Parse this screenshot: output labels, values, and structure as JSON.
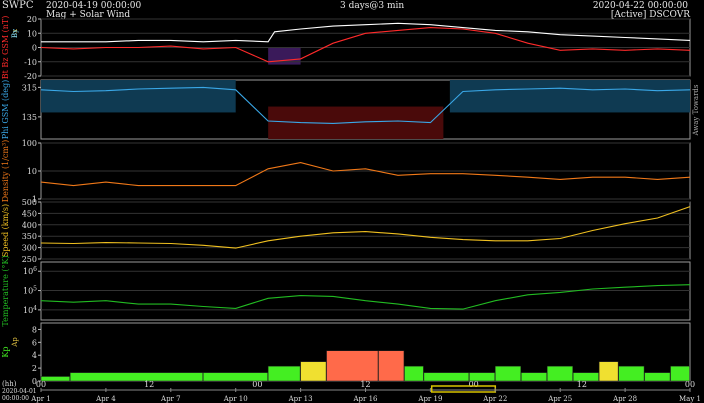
{
  "header": {
    "org": "SWPC",
    "range_start": "2020-04-19 00:00:00",
    "subtitle": "Mag + Solar Wind",
    "span": "3 days@3 min",
    "range_end": "2020-04-22 00:00:00",
    "source": "[Active] DSCOVR"
  },
  "colors": {
    "bt": "#ffffff",
    "bz": "#ff2a2a",
    "phi": "#3aa8e8",
    "density": "#f07818",
    "speed": "#f0c020",
    "temperature": "#22bb22",
    "kp_low": "#44ee22",
    "kp_mid": "#f0e030",
    "kp_high": "#ff6a4a",
    "slider": "#d9c400"
  },
  "side_label": "Away Towards",
  "time_axis": {
    "hour_label": "(hh)",
    "date_label": "2020-04-01",
    "time_label": "00:00:00",
    "hour_ticks": [
      "00",
      "12",
      "00",
      "12",
      "00",
      "12",
      "00"
    ],
    "date_ticks": [
      "Apr 1",
      "Apr 4",
      "Apr 7",
      "Apr 10",
      "Apr 13",
      "Apr 16",
      "Apr 19",
      "Apr 22",
      "Apr 25",
      "Apr 28",
      "May 1"
    ]
  },
  "chart_data": [
    {
      "type": "line",
      "ylabel": "Bt  Bz GSM (nT)",
      "extra_labels": [
        "Bx",
        "By"
      ],
      "yticks": [
        20,
        10,
        0,
        -10,
        -20
      ],
      "ylim": [
        -20,
        20
      ],
      "grid": true,
      "series": [
        {
          "name": "Bt",
          "x": [
            0,
            0.05,
            0.1,
            0.15,
            0.2,
            0.25,
            0.3,
            0.35,
            0.36,
            0.4,
            0.45,
            0.5,
            0.55,
            0.6,
            0.65,
            0.7,
            0.75,
            0.8,
            0.85,
            0.9,
            0.95,
            1
          ],
          "y": [
            4,
            4,
            4,
            5,
            5,
            4,
            5,
            4,
            11,
            13,
            15,
            16,
            17,
            16,
            14,
            12,
            11,
            9,
            8,
            7,
            6,
            5
          ]
        },
        {
          "name": "Bz",
          "x": [
            0,
            0.05,
            0.1,
            0.15,
            0.2,
            0.25,
            0.3,
            0.35,
            0.4,
            0.45,
            0.5,
            0.55,
            0.6,
            0.65,
            0.7,
            0.75,
            0.8,
            0.85,
            0.9,
            0.95,
            1
          ],
          "y": [
            0,
            -1,
            0,
            0,
            1,
            -1,
            0,
            -10,
            -8,
            3,
            10,
            12,
            14,
            13,
            10,
            3,
            -2,
            -1,
            -2,
            -1,
            -2
          ]
        }
      ]
    },
    {
      "type": "line",
      "ylabel": "Phi GSM (deg)",
      "yticks": [
        315,
        135
      ],
      "ylim": [
        0,
        360
      ],
      "grid": false,
      "series": [
        {
          "name": "Phi",
          "x": [
            0,
            0.05,
            0.1,
            0.15,
            0.2,
            0.25,
            0.3,
            0.35,
            0.4,
            0.45,
            0.5,
            0.55,
            0.6,
            0.65,
            0.7,
            0.75,
            0.8,
            0.85,
            0.9,
            0.95,
            1
          ],
          "y": [
            300,
            290,
            295,
            305,
            310,
            315,
            300,
            110,
            100,
            95,
            105,
            110,
            100,
            290,
            300,
            305,
            310,
            300,
            305,
            295,
            300
          ]
        }
      ]
    },
    {
      "type": "line",
      "ylabel": "Density (1/cm³)",
      "yticks": [
        100,
        10,
        1
      ],
      "yscale": "log",
      "ylim": [
        1,
        100
      ],
      "grid": true,
      "series": [
        {
          "name": "Density",
          "x": [
            0,
            0.05,
            0.1,
            0.15,
            0.2,
            0.25,
            0.3,
            0.35,
            0.4,
            0.45,
            0.5,
            0.55,
            0.6,
            0.65,
            0.7,
            0.75,
            0.8,
            0.85,
            0.9,
            0.95,
            1
          ],
          "y": [
            4,
            3,
            4,
            3,
            3,
            3,
            3,
            12,
            20,
            10,
            12,
            7,
            8,
            8,
            7,
            6,
            5,
            6,
            6,
            5,
            6
          ]
        }
      ]
    },
    {
      "type": "line",
      "ylabel": "Speed (km/s)",
      "yticks": [
        500,
        450,
        400,
        350,
        300,
        250
      ],
      "ylim": [
        250,
        500
      ],
      "grid": true,
      "series": [
        {
          "name": "Speed",
          "x": [
            0,
            0.05,
            0.1,
            0.15,
            0.2,
            0.25,
            0.3,
            0.35,
            0.4,
            0.45,
            0.5,
            0.55,
            0.6,
            0.65,
            0.7,
            0.75,
            0.8,
            0.85,
            0.9,
            0.95,
            1
          ],
          "y": [
            320,
            318,
            322,
            320,
            318,
            310,
            298,
            330,
            350,
            365,
            370,
            360,
            345,
            335,
            330,
            330,
            340,
            375,
            405,
            430,
            480
          ]
        }
      ]
    },
    {
      "type": "line",
      "ylabel": "Temperature (°K)",
      "yticks": [
        "10^6",
        "10^5",
        "10^4"
      ],
      "yscale": "log",
      "ylim": [
        3000,
        3000000
      ],
      "grid": true,
      "series": [
        {
          "name": "Temperature",
          "x": [
            0,
            0.05,
            0.1,
            0.15,
            0.2,
            0.25,
            0.3,
            0.35,
            0.4,
            0.45,
            0.5,
            0.55,
            0.6,
            0.65,
            0.7,
            0.75,
            0.8,
            0.85,
            0.9,
            0.95,
            1
          ],
          "y": [
            30000,
            25000,
            30000,
            20000,
            20000,
            15000,
            12000,
            40000,
            55000,
            50000,
            30000,
            20000,
            12000,
            11000,
            30000,
            60000,
            80000,
            120000,
            150000,
            180000,
            200000
          ]
        }
      ]
    },
    {
      "type": "bar",
      "ylabel": "Kp",
      "extra_labels": [
        "Ap"
      ],
      "yticks": [
        8,
        6,
        4,
        2,
        0
      ],
      "ylim": [
        0,
        9
      ],
      "x_start": [
        0,
        0.045,
        0.25,
        0.35,
        0.4,
        0.44,
        0.52,
        0.56,
        0.59,
        0.66,
        0.7,
        0.74,
        0.78,
        0.82,
        0.86,
        0.89,
        0.93,
        0.97
      ],
      "x_end": [
        0.045,
        0.25,
        0.35,
        0.4,
        0.44,
        0.52,
        0.56,
        0.59,
        0.66,
        0.7,
        0.74,
        0.78,
        0.82,
        0.86,
        0.89,
        0.93,
        0.97,
        1
      ],
      "values": [
        0.7,
        1.3,
        1.3,
        2.3,
        3,
        4.7,
        4.7,
        2.3,
        1.3,
        1.3,
        2.3,
        1.3,
        2.3,
        1.3,
        3,
        2.3,
        1.3,
        2.3
      ]
    }
  ]
}
